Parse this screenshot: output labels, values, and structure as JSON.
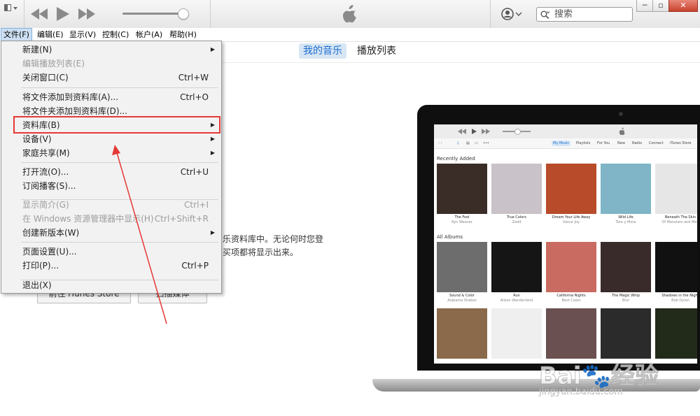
{
  "menubar": {
    "items": [
      "文件(F)",
      "编辑(E)",
      "显示(V)",
      "控制(C)",
      "帐户(A)",
      "帮助(H)"
    ]
  },
  "search": {
    "placeholder": "搜索"
  },
  "tabs": {
    "my_music": "我的音乐",
    "playlists": "播放列表"
  },
  "main": {
    "desc_line1": "乐资料库中。无论何时您登",
    "desc_line2": "买项都将显示出来。",
    "btn_store": "前往 iTunes Store",
    "btn_scan": "扫描媒体"
  },
  "file_menu": {
    "items": [
      {
        "label": "新建(N)",
        "shortcut": "",
        "submenu": true,
        "disabled": false
      },
      {
        "label": "编辑播放列表(E)",
        "shortcut": "",
        "submenu": false,
        "disabled": true
      },
      {
        "label": "关闭窗口(C)",
        "shortcut": "Ctrl+W",
        "submenu": false,
        "disabled": false
      },
      {
        "label": "将文件添加到资料库(A)...",
        "shortcut": "Ctrl+O",
        "submenu": false,
        "disabled": false
      },
      {
        "label": "将文件夹添加到资料库(D)...",
        "shortcut": "",
        "submenu": false,
        "disabled": false
      },
      {
        "label": "资料库(B)",
        "shortcut": "",
        "submenu": true,
        "disabled": false
      },
      {
        "label": "设备(V)",
        "shortcut": "",
        "submenu": true,
        "disabled": false
      },
      {
        "label": "家庭共享(M)",
        "shortcut": "",
        "submenu": true,
        "disabled": false
      },
      {
        "label": "打开流(O)...",
        "shortcut": "Ctrl+U",
        "submenu": false,
        "disabled": false
      },
      {
        "label": "订阅播客(S)...",
        "shortcut": "",
        "submenu": false,
        "disabled": false
      },
      {
        "label": "显示简介(G)",
        "shortcut": "Ctrl+I",
        "submenu": false,
        "disabled": true
      },
      {
        "label": "在 Windows 资源管理器中显示(H)",
        "shortcut": "Ctrl+Shift+R",
        "submenu": false,
        "disabled": true
      },
      {
        "label": "创建新版本(W)",
        "shortcut": "",
        "submenu": true,
        "disabled": false
      },
      {
        "label": "页面设置(U)...",
        "shortcut": "",
        "submenu": false,
        "disabled": false
      },
      {
        "label": "打印(P)...",
        "shortcut": "Ctrl+P",
        "submenu": false,
        "disabled": false
      },
      {
        "label": "退出(X)",
        "shortcut": "",
        "submenu": false,
        "disabled": false
      }
    ]
  },
  "laptop_screen": {
    "nav": [
      "My Music",
      "Playlists",
      "For You",
      "New",
      "Radio",
      "Connect",
      "iTunes Store"
    ],
    "recently_added": "Recently Added",
    "all_albums": "All Albums",
    "row1": [
      {
        "title": "The Fool",
        "artist": "Ryn Weaver",
        "color": "#3a2d27"
      },
      {
        "title": "True Colors",
        "artist": "Zedd",
        "color": "#c9c2c8"
      },
      {
        "title": "Dream Your Life Away",
        "artist": "Vance Joy",
        "color": "#b74b2a"
      },
      {
        "title": "Wild Life",
        "artist": "Tora y Mora",
        "color": "#7fb5c7"
      },
      {
        "title": "Beneath The Skin",
        "artist": "Of Monsters and Men",
        "color": "#e6e6e6"
      },
      {
        "title": "Loves Wa",
        "artist": "",
        "color": "#222222"
      }
    ],
    "row2": [
      {
        "title": "Sound & Color",
        "artist": "Alabama Shakes",
        "color": "#6d6d6d"
      },
      {
        "title": "Run",
        "artist": "Alison Wonderland",
        "color": "#151515"
      },
      {
        "title": "California Nights",
        "artist": "Best Coast",
        "color": "#c96b60"
      },
      {
        "title": "The Magic Whip",
        "artist": "Blur",
        "color": "#3a2b2b"
      },
      {
        "title": "Shadows in the Night",
        "artist": "Bob Dylan",
        "color": "#111111"
      },
      {
        "title": "",
        "artist": "",
        "color": "#3b1a1a"
      }
    ],
    "row3": [
      {
        "color": "#8a6a4a"
      },
      {
        "color": "#efefef"
      },
      {
        "color": "#6a5050"
      },
      {
        "color": "#2b2b2b"
      },
      {
        "color": "#222a1a"
      },
      {
        "color": "#3a3a3a"
      }
    ]
  },
  "watermark": {
    "brand": "Bai",
    "brand2": "经验",
    "url": "jingyan.baidu.com"
  },
  "colors": {
    "accent": "#1e6fd0",
    "highlight_box": "#e53935",
    "menu_active": "#ccdff2"
  }
}
